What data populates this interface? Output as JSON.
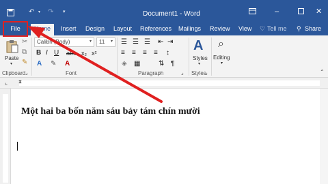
{
  "window": {
    "title": "Document1 - Word",
    "icons": [
      "save-icon",
      "undo-icon",
      "redo-icon",
      "customize-icon",
      "ribbon-display-icon",
      "minimize-icon",
      "maximize-icon",
      "close-icon"
    ]
  },
  "tabs": {
    "file": "File",
    "home": "Home",
    "insert": "Insert",
    "design": "Design",
    "layout": "Layout",
    "references": "References",
    "mailings": "Mailings",
    "review": "Review",
    "view": "View",
    "tellme": "Tell me",
    "share": "Share"
  },
  "ribbon": {
    "clipboard": {
      "paste": "Paste",
      "label": "Clipboard"
    },
    "font": {
      "name": "Calibri (Body)",
      "size": "11",
      "label": "Font"
    },
    "paragraph": {
      "label": "Paragraph"
    },
    "styles": {
      "button": "Styles",
      "label": "Styles"
    },
    "editing": {
      "button": "Editing"
    }
  },
  "document": {
    "text": "Một hai ba bốn năm sáu bảy tám chín mười"
  },
  "colors": {
    "word_blue": "#2b579a",
    "annotation_red": "#e02020"
  }
}
